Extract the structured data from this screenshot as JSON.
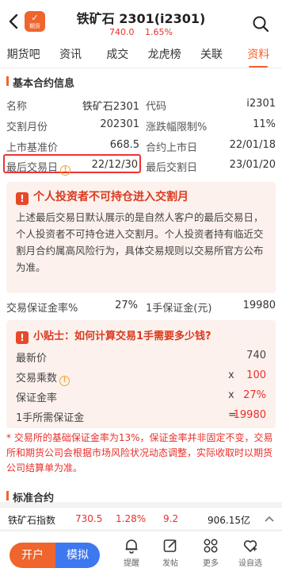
{
  "header": {
    "title": "铁矿石 2301(i2301)",
    "price": "740.0",
    "change_pct": "1.65%",
    "logo_glyph": "✓",
    "logo_text": "期货"
  },
  "tabs": [
    "期货吧",
    "资讯",
    "成交",
    "龙虎榜",
    "关联",
    "资料"
  ],
  "active_tab": "资料",
  "basic": {
    "section_title": "基本合约信息",
    "rows": [
      {
        "l1": "名称",
        "v1": "铁矿石2301",
        "l2": "代码",
        "v2": "i2301"
      },
      {
        "l1": "交割月份",
        "v1": "202301",
        "l2": "涨跌幅限制%",
        "v2": "11%"
      },
      {
        "l1": "上市基准价",
        "v1": "668.5",
        "l2": "合约上市日",
        "v2": "22/01/18"
      },
      {
        "l1": "最后交易日",
        "v1": "22/12/30",
        "l2": "最后交割日",
        "v2": "23/01/20"
      }
    ]
  },
  "notice": {
    "badge": "!",
    "title": "个人投资者不可持仓进入交割月",
    "body": "上述最后交易日默认展示的是自然人客户的最后交易日，个人投资者不可持仓进入交割月。个人投资者持有临近交割月合约属高风险行为，具体交易规则以交易所官方公布为准。"
  },
  "margin": {
    "rate_label": "交易保证金率%",
    "rate_value": "27%",
    "per_lot_label": "1手保证金(元)",
    "per_lot_value": "19980"
  },
  "tips": {
    "title": "小贴士：如何计算交易1手需要多少钱?",
    "rows": [
      {
        "label": "最新价",
        "op": "",
        "value": "740"
      },
      {
        "label": "交易乘数",
        "op": "x",
        "value": "100"
      },
      {
        "label": "保证金率",
        "op": "x",
        "value": "27%"
      },
      {
        "label": "1手所需保证金",
        "op": "=",
        "value": "19980"
      }
    ]
  },
  "footnote": "* 交易所的基础保证金率为13%，保证金率并非固定不变，交易所和期货公司会根据市场风险状况动态调整，实际收取时以期货公司结算单为准。",
  "standard_section_title": "标准合约",
  "ticker": {
    "name": "铁矿石指数",
    "price": "730.5",
    "change_pct": "1.28%",
    "change": "9.2",
    "volume": "906.15亿"
  },
  "bottom": {
    "open_label": "开户",
    "sim_label": "模拟",
    "nav": [
      {
        "icon": "bell-icon",
        "label": "提醒"
      },
      {
        "icon": "edit-icon",
        "label": "发帖"
      },
      {
        "icon": "grid-icon",
        "label": "更多"
      },
      {
        "icon": "heart-icon",
        "label": "设自选"
      }
    ]
  }
}
